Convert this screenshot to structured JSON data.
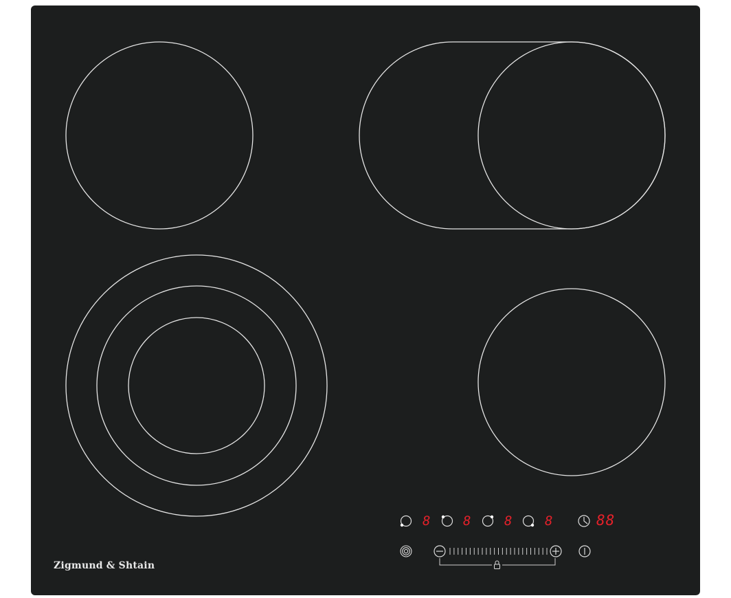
{
  "brand": "Zigmund & Shtain",
  "colors": {
    "glass": "#1c1e1e",
    "outline": "#e6e6e6",
    "display_red": "#e5212a",
    "background": "#ffffff"
  },
  "zones": [
    {
      "name": "rear-left",
      "shape": "circle"
    },
    {
      "name": "rear-right",
      "shape": "oval-extended"
    },
    {
      "name": "front-left",
      "shape": "triple-ring"
    },
    {
      "name": "front-right",
      "shape": "circle"
    }
  ],
  "controls": {
    "zone_displays": [
      "8",
      "8",
      "8",
      "8"
    ],
    "zone_select_icons": [
      "zone-select-icon",
      "zone-select-icon",
      "zone-select-icon",
      "zone-select-icon"
    ],
    "timer_icon": "clock-icon",
    "timer_display": "88",
    "dual_zone_icon": "concentric-circles-icon",
    "minus_icon": "minus-icon",
    "plus_icon": "plus-icon",
    "slider": "slider-ticks",
    "lock_icon": "lock-icon",
    "power_icon": "power-icon"
  }
}
